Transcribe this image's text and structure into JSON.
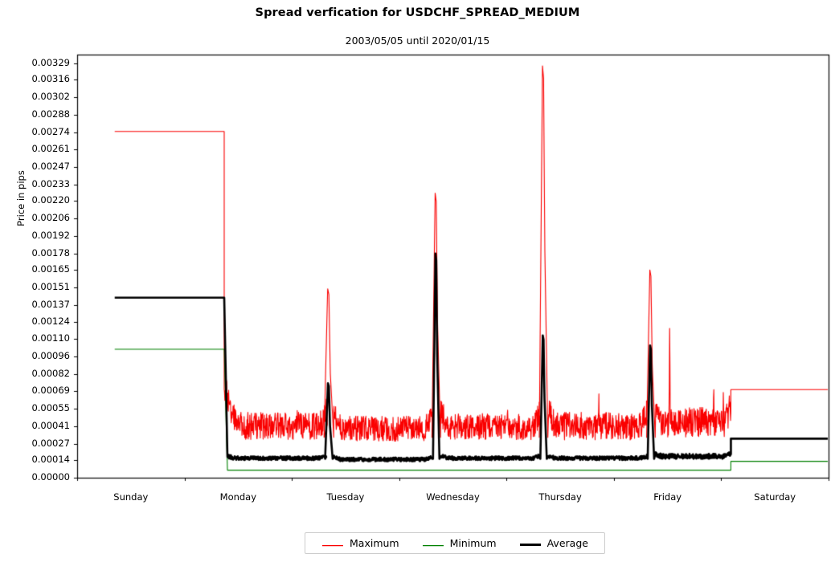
{
  "chart_data": {
    "type": "line",
    "title": "Spread verfication for USDCHF_SPREAD_MEDIUM",
    "subtitle": "2003/05/05 until 2020/01/15",
    "xlabel": "",
    "ylabel": "Price in pips",
    "grid": false,
    "legend_position": "bottom-center",
    "xlim": [
      0,
      7
    ],
    "ylim": [
      0.0,
      0.00336
    ],
    "x_tick_positions": [
      0,
      1,
      2,
      3,
      4,
      5,
      6,
      7
    ],
    "categories": [
      "Sunday",
      "Monday",
      "Tuesday",
      "Wednesday",
      "Thursday",
      "Friday",
      "Saturday"
    ],
    "y_tick_values": [
      0.0,
      0.00014,
      0.00027,
      0.00041,
      0.00055,
      0.00069,
      0.00082,
      0.00096,
      0.0011,
      0.00124,
      0.00137,
      0.00151,
      0.00165,
      0.00178,
      0.00192,
      0.00206,
      0.0022,
      0.00233,
      0.00247,
      0.00261,
      0.00274,
      0.00288,
      0.00302,
      0.00316,
      0.00329
    ],
    "y_tick_labels": [
      "0.00000",
      "0.00014",
      "0.00027",
      "0.00041",
      "0.00055",
      "0.00069",
      "0.00082",
      "0.00096",
      "0.00110",
      "0.00124",
      "0.00137",
      "0.00151",
      "0.00165",
      "0.00178",
      "0.00192",
      "0.00206",
      "0.00220",
      "0.00233",
      "0.00247",
      "0.00261",
      "0.00274",
      "0.00288",
      "0.00302",
      "0.00316",
      "0.00329"
    ],
    "series": [
      {
        "name": "Maximum",
        "color": "#fa0000",
        "width": 1.1,
        "segments": [
          {
            "kind": "flat",
            "x_start": 0.35,
            "x_end": 1.37,
            "value": 0.00275
          },
          {
            "kind": "noise",
            "x_start": 1.37,
            "x_end": 2.33,
            "baseline": 0.0003,
            "amplitude": 0.00022,
            "decay_from": 0.0005,
            "spike_x": [
              2.05
            ],
            "spike_value": [
              0.00055
            ],
            "seed": 11
          },
          {
            "kind": "peak",
            "x_center": 2.345,
            "half_width": 0.045,
            "value": 0.0015,
            "base": 0.00032
          },
          {
            "kind": "noise",
            "x_start": 2.39,
            "x_end": 3.31,
            "baseline": 0.00029,
            "amplitude": 0.0002,
            "spike_x": [
              3.07
            ],
            "spike_value": [
              0.00056
            ],
            "seed": 23
          },
          {
            "kind": "peak",
            "x_center": 3.345,
            "half_width": 0.04,
            "value": 0.00226,
            "base": 0.00032
          },
          {
            "kind": "noise",
            "x_start": 3.39,
            "x_end": 4.31,
            "baseline": 0.0003,
            "amplitude": 0.00021,
            "spike_x": [
              4.01
            ],
            "spike_value": [
              0.00055
            ],
            "seed": 37
          },
          {
            "kind": "peak",
            "x_center": 4.345,
            "half_width": 0.04,
            "value": 0.00327,
            "base": 0.00032
          },
          {
            "kind": "noise",
            "x_start": 4.39,
            "x_end": 5.31,
            "baseline": 0.0003,
            "amplitude": 0.00022,
            "spike_x": [
              4.86
            ],
            "spike_value": [
              0.00069
            ],
            "seed": 51
          },
          {
            "kind": "peak",
            "x_center": 5.345,
            "half_width": 0.04,
            "value": 0.00165,
            "base": 0.00032
          },
          {
            "kind": "noise",
            "x_start": 5.39,
            "x_end": 6.09,
            "baseline": 0.00032,
            "amplitude": 0.00024,
            "spike_x": [
              5.52,
              5.93,
              6.02
            ],
            "spike_value": [
              0.00128,
              0.00082,
              0.00073
            ],
            "seed": 67
          },
          {
            "kind": "flat",
            "x_start": 6.09,
            "x_end": 7.3,
            "value": 0.0007
          }
        ]
      },
      {
        "name": "Minimum",
        "color": "#008000",
        "width": 1.1,
        "segments": [
          {
            "kind": "flat",
            "x_start": 0.35,
            "x_end": 1.37,
            "value": 0.00102
          },
          {
            "kind": "flat",
            "x_start": 1.4,
            "x_end": 6.09,
            "value": 6e-05
          },
          {
            "kind": "flat",
            "x_start": 6.09,
            "x_end": 7.25,
            "value": 0.00013
          }
        ]
      },
      {
        "name": "Average",
        "color": "#000000",
        "width": 2.6,
        "segments": [
          {
            "kind": "flat",
            "x_start": 0.35,
            "x_end": 1.37,
            "value": 0.00143
          },
          {
            "kind": "noise",
            "x_start": 1.4,
            "x_end": 2.32,
            "baseline": 0.00014,
            "amplitude": 3e-05,
            "seed": 5
          },
          {
            "kind": "peak",
            "x_center": 2.345,
            "half_width": 0.035,
            "value": 0.00075,
            "base": 0.00015
          },
          {
            "kind": "noise",
            "x_start": 2.39,
            "x_end": 3.31,
            "baseline": 0.00013,
            "amplitude": 3e-05,
            "seed": 9
          },
          {
            "kind": "peak",
            "x_center": 3.345,
            "half_width": 0.03,
            "value": 0.00178,
            "base": 0.00015
          },
          {
            "kind": "noise",
            "x_start": 3.39,
            "x_end": 4.31,
            "baseline": 0.00014,
            "amplitude": 3e-05,
            "seed": 13
          },
          {
            "kind": "peak",
            "x_center": 4.345,
            "half_width": 0.03,
            "value": 0.00113,
            "base": 0.00015
          },
          {
            "kind": "noise",
            "x_start": 4.39,
            "x_end": 5.31,
            "baseline": 0.00014,
            "amplitude": 3e-05,
            "seed": 17
          },
          {
            "kind": "peak",
            "x_center": 5.345,
            "half_width": 0.03,
            "value": 0.00105,
            "base": 0.00015
          },
          {
            "kind": "noise",
            "x_start": 5.39,
            "x_end": 6.09,
            "baseline": 0.00015,
            "amplitude": 4e-05,
            "seed": 29
          },
          {
            "kind": "flat",
            "x_start": 6.09,
            "x_end": 7.3,
            "value": 0.00031
          }
        ]
      }
    ],
    "legend": [
      {
        "label": "Maximum",
        "color": "#fa0000",
        "width": 1.2
      },
      {
        "label": "Minimum",
        "color": "#008000",
        "width": 1.2
      },
      {
        "label": "Average",
        "color": "#000000",
        "width": 3
      }
    ]
  },
  "axes": {
    "frame_color": "#000000",
    "background": "#ffffff"
  }
}
